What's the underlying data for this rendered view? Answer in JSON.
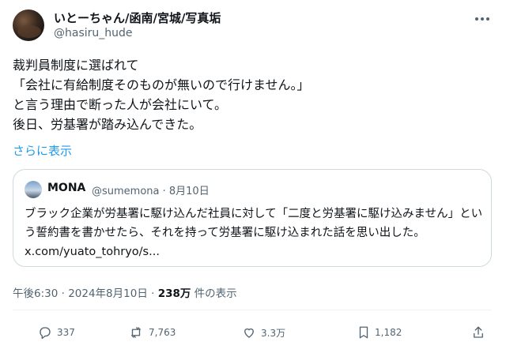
{
  "author": {
    "name": "いとーちゃん/函南/宮城/写真垢",
    "handle": "@hasiru_hude"
  },
  "post": {
    "text": "裁判員制度に選ばれて\n「会社に有給制度そのものが無いので行けません。」\nと言う理由で断った人が会社にいて。\n後日、労基署が踏み込んできた。",
    "show_more": "さらに表示"
  },
  "quoted": {
    "name": "MONA",
    "meta": "@sumemona · 8月10日",
    "text": "ブラック企業が労基署に駆け込んだ社員に対して「二度と労基署に駆け込みません」という誓約書を書かせたら、それを持って労基署に駆け込まれた話を思い出した。",
    "link": "x.com/yuato_tohryo/s..."
  },
  "timestamp": "午後6:30 · 2024年8月10日 · ",
  "views_count": "238万",
  "views_label": " 件の表示",
  "actions": {
    "replies": "337",
    "reposts": "7,763",
    "likes": "3.3万",
    "bookmarks": "1,182"
  }
}
